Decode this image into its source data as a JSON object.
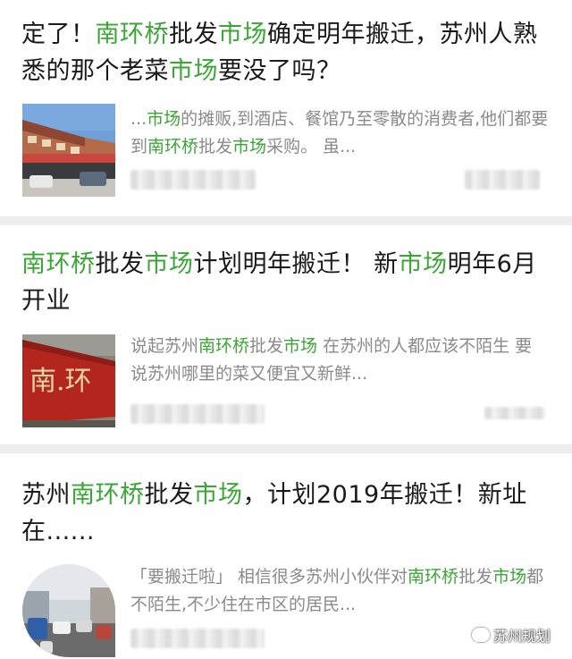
{
  "articles": [
    {
      "title": [
        {
          "t": "定了！",
          "hl": false
        },
        {
          "t": "南环桥",
          "hl": true
        },
        {
          "t": "批发",
          "hl": false
        },
        {
          "t": "市场",
          "hl": true
        },
        {
          "t": "确定明年搬迁，苏州人熟悉的那个老菜",
          "hl": false
        },
        {
          "t": "市场",
          "hl": true
        },
        {
          "t": "要没了吗？",
          "hl": false
        }
      ],
      "snippet": [
        {
          "t": "...",
          "hl": false
        },
        {
          "t": "市场",
          "hl": true
        },
        {
          "t": "的摊贩,到酒店、餐馆乃至零散的消费者,他们都要到",
          "hl": false
        },
        {
          "t": "南环桥",
          "hl": true
        },
        {
          "t": "批发",
          "hl": false
        },
        {
          "t": "市场",
          "hl": true
        },
        {
          "t": "采购。 虽...",
          "hl": false
        }
      ],
      "thumb_icon": "market-building-photo"
    },
    {
      "title": [
        {
          "t": "南环桥",
          "hl": true
        },
        {
          "t": "批发",
          "hl": false
        },
        {
          "t": "市场",
          "hl": true
        },
        {
          "t": "计划明年搬迁！ 新",
          "hl": false
        },
        {
          "t": "市场",
          "hl": true
        },
        {
          "t": "明年6月开业",
          "hl": false
        }
      ],
      "snippet": [
        {
          "t": "说起苏州",
          "hl": false
        },
        {
          "t": "南环桥",
          "hl": true
        },
        {
          "t": "批发",
          "hl": false
        },
        {
          "t": "市场",
          "hl": true
        },
        {
          "t": " 在苏州的人都应该不陌生 要说苏州哪里的菜又便宜又新鲜...",
          "hl": false
        }
      ],
      "thumb_icon": "red-sign-photo",
      "thumb_sign_text": "南.环"
    },
    {
      "title": [
        {
          "t": "苏州",
          "hl": false
        },
        {
          "t": "南环桥",
          "hl": true
        },
        {
          "t": "批发",
          "hl": false
        },
        {
          "t": "市场",
          "hl": true
        },
        {
          "t": "，计划2019年搬迁！新址在......",
          "hl": false
        }
      ],
      "snippet": [
        {
          "t": "「要搬迁啦」 相信很多苏州小伙伴对",
          "hl": false
        },
        {
          "t": "南环桥",
          "hl": true
        },
        {
          "t": "批发",
          "hl": false
        },
        {
          "t": "市场",
          "hl": true
        },
        {
          "t": "都不陌生,不少住在市区的居民...",
          "hl": false
        }
      ],
      "thumb_icon": "street-traffic-photo"
    }
  ],
  "watermark": {
    "text": "苏州规划",
    "icon": "wechat-bubble-icon"
  },
  "colors": {
    "highlight": "#3aa735",
    "title": "#1a1a1a",
    "snippet": "#8a8a8a",
    "separator": "#eeeeee"
  }
}
